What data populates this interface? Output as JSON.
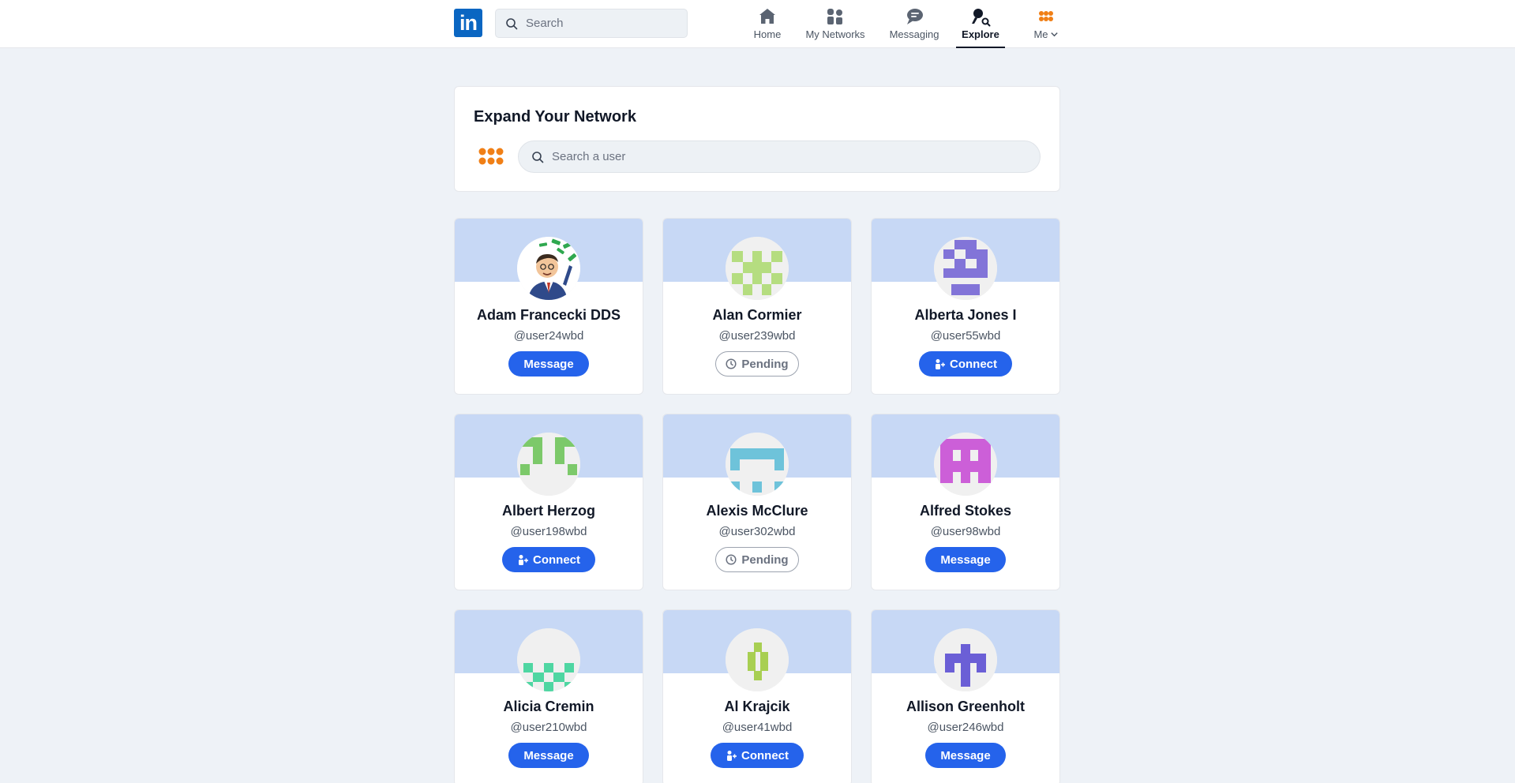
{
  "nav": {
    "logo_text": "in",
    "search_placeholder": "Search",
    "items": [
      {
        "label": "Home",
        "icon": "home-icon"
      },
      {
        "label": "My Networks",
        "icon": "people-icon"
      },
      {
        "label": "Messaging",
        "icon": "chat-icon"
      },
      {
        "label": "Explore",
        "icon": "explore-icon",
        "active": true
      },
      {
        "label": "Me",
        "icon": "grid-dots-icon"
      }
    ]
  },
  "expand": {
    "title": "Expand Your Network",
    "search_placeholder": "Search a user"
  },
  "users": [
    {
      "name": "Adam Francecki DDS",
      "handle": "@user24wbd",
      "action": "Message"
    },
    {
      "name": "Alan Cormier",
      "handle": "@user239wbd",
      "action": "Pending"
    },
    {
      "name": "Alberta Jones I",
      "handle": "@user55wbd",
      "action": "Connect"
    },
    {
      "name": "Albert Herzog",
      "handle": "@user198wbd",
      "action": "Connect"
    },
    {
      "name": "Alexis McClure",
      "handle": "@user302wbd",
      "action": "Pending"
    },
    {
      "name": "Alfred Stokes",
      "handle": "@user98wbd",
      "action": "Message"
    },
    {
      "name": "Alicia Cremin",
      "handle": "@user210wbd",
      "action": "Message"
    },
    {
      "name": "Al Krajcik",
      "handle": "@user41wbd",
      "action": "Connect"
    },
    {
      "name": "Allison Greenholt",
      "handle": "@user246wbd",
      "action": "Message"
    }
  ],
  "colors": {
    "primary": "#2563eb",
    "brand": "#0a66c2",
    "accent_orange": "#f07f16",
    "banner": "#c7d8f5"
  }
}
